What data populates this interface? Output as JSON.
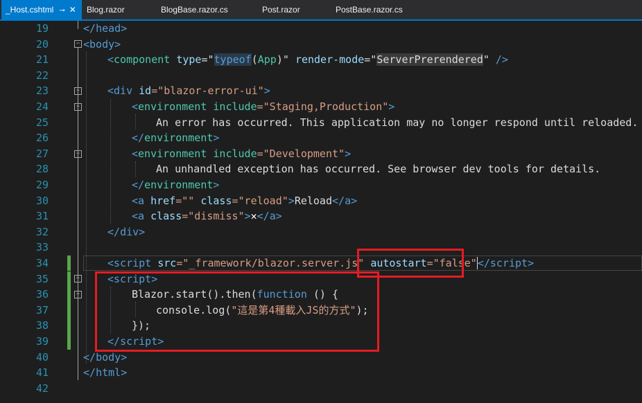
{
  "tabs": [
    {
      "label": "_Host.cshtml",
      "active": true,
      "pin": "⊸",
      "close": "✕"
    },
    {
      "label": "Blog.razor"
    },
    {
      "label": "BlogBase.razor.cs"
    },
    {
      "label": "Post.razor"
    },
    {
      "label": "PostBase.razor.cs"
    }
  ],
  "line_numbers": [
    "19",
    "20",
    "21",
    "22",
    "23",
    "24",
    "25",
    "26",
    "27",
    "28",
    "29",
    "30",
    "31",
    "32",
    "33",
    "34",
    "35",
    "36",
    "37",
    "38",
    "39",
    "40",
    "41",
    "42"
  ],
  "code": {
    "l19": {
      "a": "</",
      "b": "head",
      "c": ">"
    },
    "l20": {
      "a": "<",
      "b": "body",
      "c": ">"
    },
    "l21": {
      "a": "<",
      "b": "component",
      "c": "type",
      "d": "=\"",
      "e": "typeof",
      "f": "(",
      "g": "App",
      "h": ")\"",
      "i": "render-mode",
      "j": "=\"",
      "k": "ServerPrerendered",
      "l": "\"",
      "m": " />"
    },
    "l23": {
      "a": "<",
      "b": "div",
      "c": "id",
      "d": "=\"blazor-error-ui\"",
      "e": ">"
    },
    "l24": {
      "a": "<",
      "b": "environment",
      "c": "include",
      "d": "=\"Staging,Production\"",
      "e": ">"
    },
    "l25": "An error has occurred. This application may no longer respond until reloaded.",
    "l26": {
      "a": "</",
      "b": "environment",
      "c": ">"
    },
    "l27": {
      "a": "<",
      "b": "environment",
      "c": "include",
      "d": "=\"Development\"",
      "e": ">"
    },
    "l28": "An unhandled exception has occurred. See browser dev tools for details.",
    "l29": {
      "a": "</",
      "b": "environment",
      "c": ">"
    },
    "l30": {
      "a": "<",
      "b": "a",
      "c": "href",
      "d": "=\"\"",
      "e": "class",
      "f": "=\"reload\"",
      "g": ">",
      "h": "Reload",
      "i": "</",
      "j": "a",
      "k": ">"
    },
    "l31": {
      "a": "<",
      "b": "a",
      "c": "class",
      "d": "=\"dismiss\"",
      "e": ">",
      "f": "✕",
      "g": "</",
      "h": "a",
      "i": ">"
    },
    "l32": {
      "a": "</",
      "b": "div",
      "c": ">"
    },
    "l34": {
      "a": "<",
      "b": "script",
      "c": "src",
      "d": "=\"_framework/blazor.server.js\"",
      "e": "autostart",
      "f": "=\"false\"",
      "g": "</",
      "h": "script",
      "i": ">"
    },
    "l35": {
      "a": "<",
      "b": "script",
      "c": ">"
    },
    "l36": {
      "a": "Blazor.start().then(",
      "b": "function",
      "c": " () {"
    },
    "l37": {
      "a": "console.log(",
      "b": "\"這是第4種載入JS的方式\"",
      "c": ");"
    },
    "l38": "});",
    "l39": {
      "a": "</",
      "b": "script",
      "c": ">"
    },
    "l40": {
      "a": "</",
      "b": "body",
      "c": ">"
    },
    "l41": {
      "a": "</",
      "b": "html",
      "c": ">"
    }
  },
  "colors": {
    "tag": "#569cd6",
    "attr": "#9cdcfe",
    "string": "#d69d85",
    "component": "#4ec9b0",
    "line_number": "#2b91af",
    "highlight": "#e51c23",
    "change_bar": "#57a64a"
  }
}
